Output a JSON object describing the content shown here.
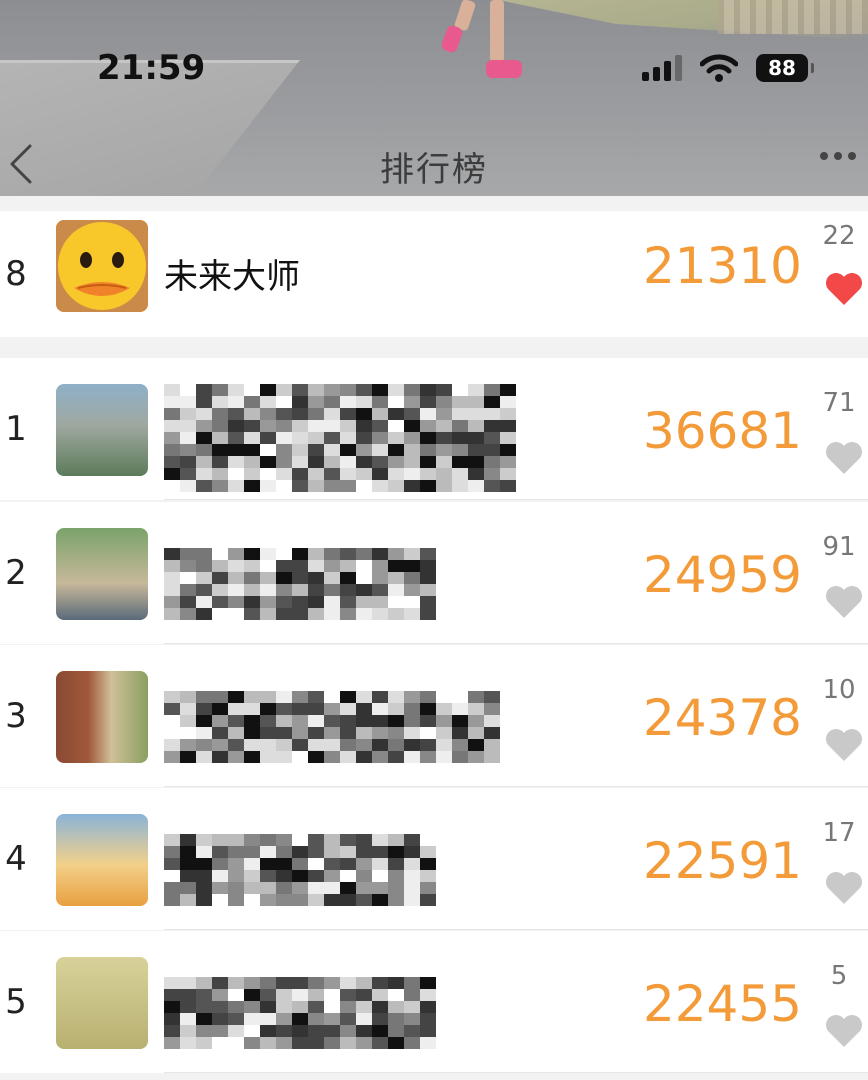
{
  "status_bar": {
    "time": "21:59",
    "battery": "88"
  },
  "nav": {
    "title": "排行榜",
    "back_icon": "chevron-left-icon",
    "more_icon": "more-dots-icon"
  },
  "my_entry": {
    "rank": "8",
    "name": "未来大师",
    "score": "21310",
    "likes": "22",
    "liked": true
  },
  "leaderboard": [
    {
      "rank": "1",
      "name_redacted": true,
      "score": "36681",
      "likes": "71",
      "liked": false
    },
    {
      "rank": "2",
      "name_redacted": true,
      "score": "24959",
      "likes": "91",
      "liked": false
    },
    {
      "rank": "3",
      "name_redacted": true,
      "score": "24378",
      "likes": "10",
      "liked": false
    },
    {
      "rank": "4",
      "name_redacted": true,
      "score": "22591",
      "likes": "17",
      "liked": false
    },
    {
      "rank": "5",
      "name_redacted": true,
      "score": "22455",
      "likes": "5",
      "liked": false
    }
  ],
  "colors": {
    "score": "#f39a39",
    "heart_liked": "#f24848",
    "heart_unliked": "#c9c9c9"
  }
}
